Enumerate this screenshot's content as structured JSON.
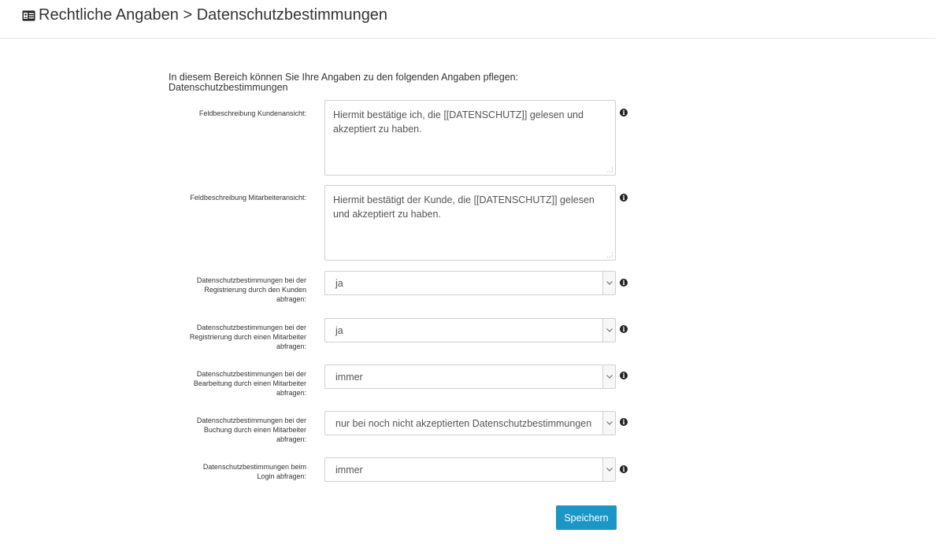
{
  "header": {
    "title": "Rechtliche Angaben > Datenschutzbestimmungen",
    "icon": "id-card-icon"
  },
  "intro": {
    "line1": "In diesem Bereich können Sie Ihre Angaben zu den folgenden Angaben pflegen:",
    "line2": "Datenschutzbestimmungen"
  },
  "fields": {
    "kundenansicht": {
      "label": "Feldbeschreibung Kundenansicht:",
      "value": "Hiermit bestätige ich, die [[DATENSCHUTZ]]  gelesen und akzeptiert zu haben."
    },
    "mitarbeiteransicht": {
      "label": "Feldbeschreibung Mitarbeiteransicht:",
      "value": "Hiermit bestätigt der Kunde, die [[DATENSCHUTZ]] gelesen und akzeptiert zu haben."
    },
    "registrierung_kunde": {
      "label_lines": [
        "Datenschutzbestimmungen bei der",
        "Registrierung durch den Kunden",
        "abfragen:"
      ],
      "value": "ja"
    },
    "registrierung_mitarbeiter": {
      "label_lines": [
        "Datenschutzbestimmungen bei der",
        "Registrierung durch einen Mitarbeiter",
        "abfragen:"
      ],
      "value": "ja"
    },
    "bearbeitung_mitarbeiter": {
      "label_lines": [
        "Datenschutzbestimmungen bei der",
        "Bearbeitung durch einen Mitarbeiter",
        "abfragen:"
      ],
      "value": "immer"
    },
    "buchung_mitarbeiter": {
      "label_lines": [
        "Datenschutzbestimmungen bei der",
        "Buchung durch einen Mitarbeiter",
        "abfragen:"
      ],
      "value": "nur bei noch nicht akzeptierten Datenschutzbestimmungen"
    },
    "login": {
      "label_lines": [
        "Datenschutzbestimmungen beim",
        "Login abfragen:"
      ],
      "value": "immer"
    }
  },
  "info_glyph": "i",
  "save_label": "Speichern",
  "colors": {
    "accent": "#1a97c6",
    "border": "#cfcfcf",
    "text": "#333333"
  }
}
